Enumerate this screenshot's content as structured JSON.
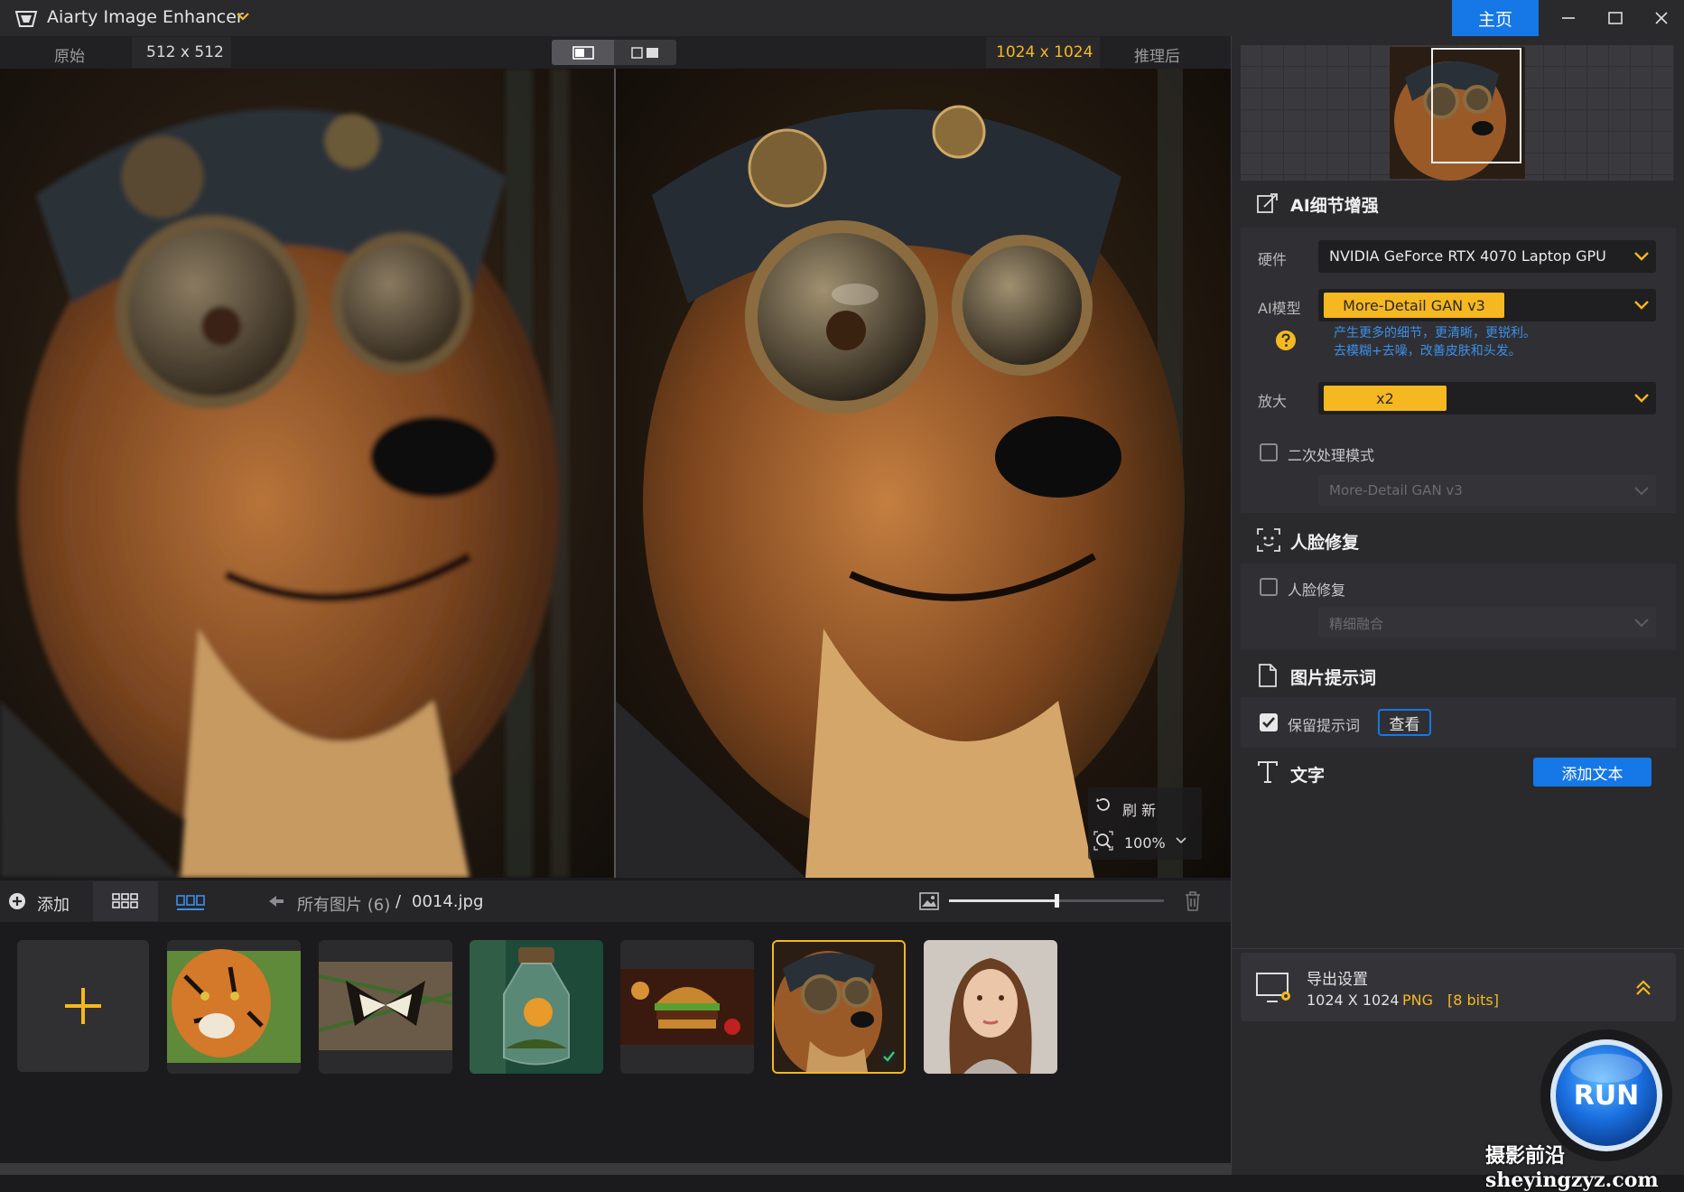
{
  "app": {
    "title": "Aiarty Image Enhancer",
    "home_label": "主页"
  },
  "compare": {
    "original_label": "原始",
    "original_size": "512 x 512",
    "enhanced_size": "1024 x 1024",
    "enhanced_label": "推理后",
    "refresh_label": "刷 新",
    "zoom_level": "100%"
  },
  "toolbar": {
    "add_label": "添加",
    "breadcrumb_all": "所有图片 (6)",
    "breadcrumb_sep": "/",
    "breadcrumb_file": "0014.jpg",
    "thumb_size_level": 0.5
  },
  "thumbnails": [
    {
      "name": "tiger",
      "selected": false
    },
    {
      "name": "butterfly",
      "selected": false
    },
    {
      "name": "terrarium-bottle",
      "selected": false
    },
    {
      "name": "burger",
      "selected": false
    },
    {
      "name": "steampunk-dog",
      "selected": true
    },
    {
      "name": "woman-portrait",
      "selected": false
    }
  ],
  "panel": {
    "ai_detail": {
      "title": "AI细节增强",
      "hardware_label": "硬件",
      "hardware_value": "NVIDIA GeForce RTX 4070 Laptop GPU",
      "model_label": "AI模型",
      "model_value": "More-Detail GAN  v3",
      "model_desc_1": "产生更多的细节，更清晰，更锐利。",
      "model_desc_2": "去模糊+去噪，改善皮肤和头发。",
      "scale_label": "放大",
      "scale_value": "x2",
      "second_pass_label": "二次处理模式",
      "second_pass_checked": false,
      "second_pass_model": "More-Detail GAN  v3"
    },
    "face": {
      "title": "人脸修复",
      "checkbox_label": "人脸修复",
      "checked": false,
      "mode_value": "精细融合"
    },
    "prompt": {
      "title": "图片提示词",
      "keep_label": "保留提示词",
      "keep_checked": true,
      "view_button": "查看"
    },
    "text": {
      "title": "文字",
      "add_button": "添加文本"
    },
    "export": {
      "title": "导出设置",
      "size": "1024 X 1024",
      "format": "PNG",
      "bits": "[8 bits]"
    },
    "run_label": "RUN"
  },
  "watermark": "摄影前沿 sheyingzyz.com",
  "colors": {
    "accent_yellow": "#f5b820",
    "accent_blue": "#1677e6",
    "desc_blue": "#3b8fe8"
  }
}
